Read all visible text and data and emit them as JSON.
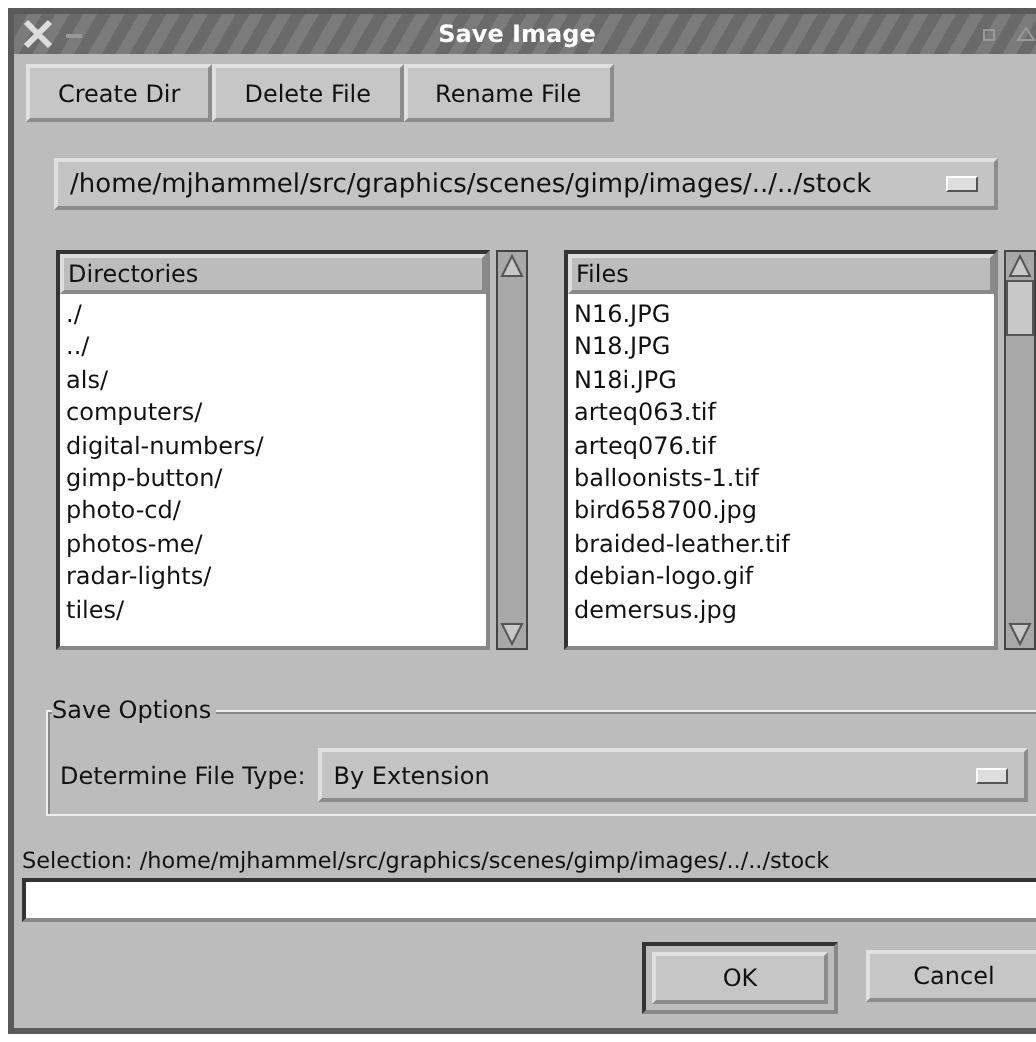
{
  "window": {
    "title": "Save Image"
  },
  "toolbar": [
    {
      "label": "Create Dir"
    },
    {
      "label": "Delete File"
    },
    {
      "label": "Rename File"
    }
  ],
  "path_dropdown": {
    "value": "/home/mjhammel/src/graphics/scenes/gimp/images/../../stock"
  },
  "directories": {
    "header": "Directories",
    "items": [
      "./",
      "../",
      "als/",
      "computers/",
      "digital-numbers/",
      "gimp-button/",
      "photo-cd/",
      "photos-me/",
      "radar-lights/",
      "tiles/"
    ]
  },
  "files": {
    "header": "Files",
    "items": [
      "N16.JPG",
      "N18.JPG",
      "N18i.JPG",
      "arteq063.tif",
      "arteq076.tif",
      "balloonists-1.tif",
      "bird658700.jpg",
      "braided-leather.tif",
      "debian-logo.gif",
      "demersus.jpg"
    ]
  },
  "save_options": {
    "title": "Save Options",
    "file_type_label": "Determine File Type:",
    "file_type_value": "By Extension"
  },
  "selection": {
    "label": "Selection: /home/mjhammel/src/graphics/scenes/gimp/images/../../stock"
  },
  "buttons": [
    {
      "label": "OK",
      "default": true
    },
    {
      "label": "Cancel",
      "default": false
    }
  ]
}
